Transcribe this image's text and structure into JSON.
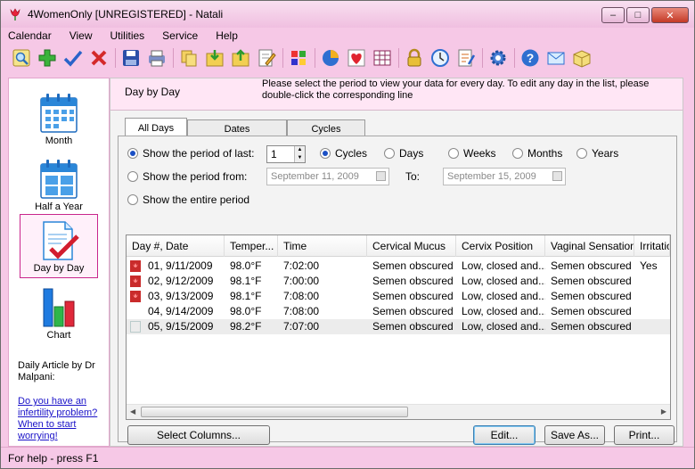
{
  "window": {
    "title": "4WomenOnly [UNREGISTERED] - Natali",
    "minimize": "–",
    "maximize": "□",
    "close": "✕"
  },
  "menu": [
    "Calendar",
    "View",
    "Utilities",
    "Service",
    "Help"
  ],
  "toolbar_icons": [
    "search-icon",
    "add-icon",
    "check-icon",
    "delete-icon",
    "save-icon",
    "print-icon",
    "copy-icon",
    "import-icon",
    "export-icon",
    "edit-icon",
    "color-icon",
    "pie-chart-icon",
    "heart-icon",
    "grid-icon",
    "lock-icon",
    "clock-icon",
    "notes-icon",
    "gear-icon",
    "help-icon",
    "mail-icon",
    "box-icon"
  ],
  "sidebar": {
    "items": [
      {
        "label": "Month"
      },
      {
        "label": "Half a Year"
      },
      {
        "label": "Day by Day"
      },
      {
        "label": "Chart"
      }
    ],
    "article_heading": "Daily Article by Dr Malpani:",
    "article_link": "Do you have an infertility problem? When to start worrying!"
  },
  "header": {
    "title": "Day by Day",
    "description": "Please select the period to view your data for every day. To edit any day in the list, please double-click the corresponding line"
  },
  "tabs": [
    "All Days",
    "Dates",
    "Cycles"
  ],
  "period": {
    "last_label": "Show the period of last:",
    "last_value": "1",
    "units": [
      "Cycles",
      "Days",
      "Weeks",
      "Months",
      "Years"
    ],
    "from_label": "Show the period from:",
    "from_date": "September 11, 2009",
    "to_label": "To:",
    "to_date": "September 15, 2009",
    "entire_label": "Show the entire period"
  },
  "table": {
    "columns": [
      "Day #, Date",
      "Temper...",
      "Time",
      "Cervical Mucus",
      "Cervix Position",
      "Vaginal Sensation",
      "Irritation"
    ],
    "rows": [
      [
        "01, 9/11/2009",
        "98.0°F",
        "7:02:00",
        "Semen obscured",
        "Low, closed and...",
        "Semen obscured",
        "Yes"
      ],
      [
        "02, 9/12/2009",
        "98.1°F",
        "7:00:00",
        "Semen obscured",
        "Low, closed and...",
        "Semen obscured",
        ""
      ],
      [
        "03, 9/13/2009",
        "98.1°F",
        "7:08:00",
        "Semen obscured",
        "Low, closed and...",
        "Semen obscured",
        ""
      ],
      [
        "04, 9/14/2009",
        "98.0°F",
        "7:08:00",
        "Semen obscured",
        "Low, closed and...",
        "Semen obscured",
        ""
      ],
      [
        "05, 9/15/2009",
        "98.2°F",
        "7:07:00",
        "Semen obscured",
        "Low, closed and...",
        "Semen obscured",
        ""
      ]
    ]
  },
  "buttons": {
    "select_columns": "Select Columns...",
    "edit": "Edit...",
    "save_as": "Save As...",
    "print": "Print..."
  },
  "status": "For help - press F1"
}
